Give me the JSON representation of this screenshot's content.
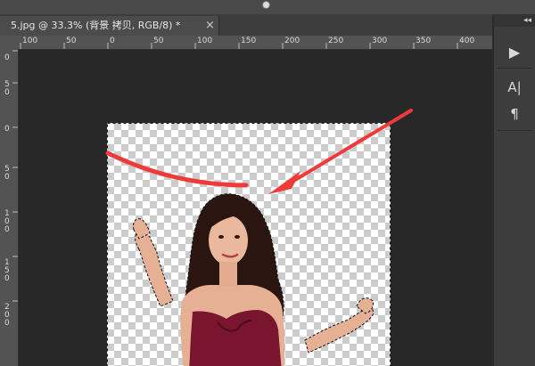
{
  "window": {
    "tab_title": "5.jpg @ 33.3% (背景 拷贝, RGB/8) *",
    "tab_close_glyph": "×",
    "collapse_glyph": "◂◂"
  },
  "rulers": {
    "horizontal": [
      "100",
      "50",
      "0",
      "50",
      "100",
      "150",
      "200",
      "250",
      "300",
      "350",
      "400"
    ],
    "vertical": [
      "0",
      "5\n0",
      "0",
      "5\n0",
      "1\n0\n0",
      "1\n5\n0",
      "2\n0\n0"
    ]
  },
  "right_panel": {
    "tools": [
      {
        "name": "play-icon",
        "glyph": "▶"
      },
      {
        "name": "character-panel-icon",
        "glyph": "A|"
      },
      {
        "name": "paragraph-panel-icon",
        "glyph": "¶"
      }
    ]
  },
  "colors": {
    "annotation": "#f03a3a",
    "dress": "#7a1530",
    "hair": "#2a1510",
    "skin": "#e8b59a"
  }
}
